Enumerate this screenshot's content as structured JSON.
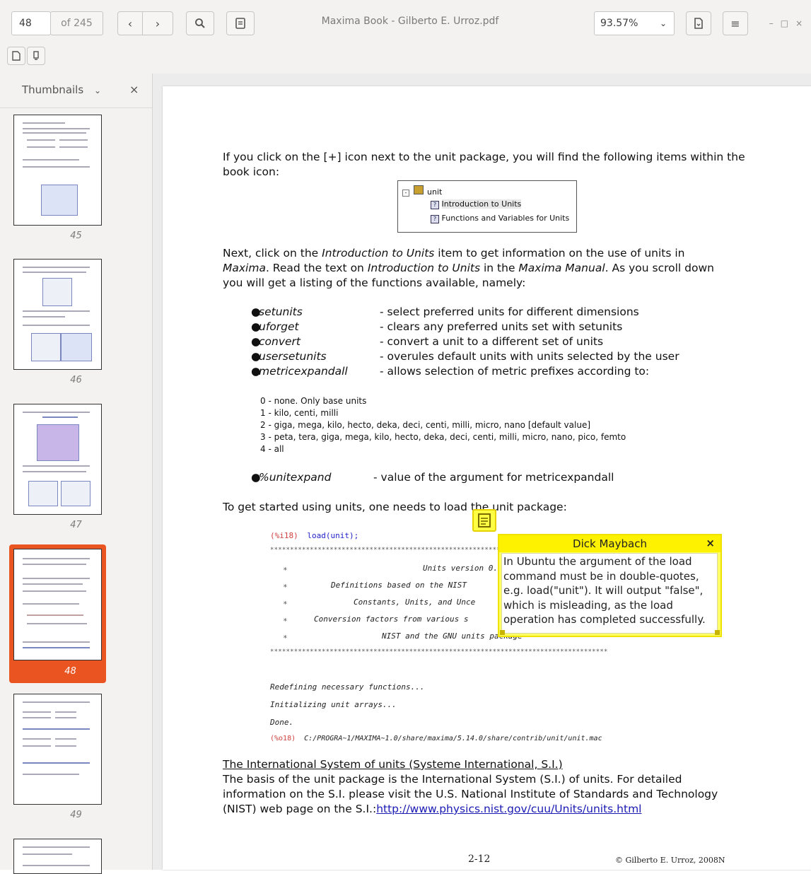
{
  "toolbar": {
    "page_current": "48",
    "page_total": "of 245",
    "document_title": "Maxima Book - Gilberto E. Urroz.pdf",
    "zoom": "93.57%"
  },
  "sidebar": {
    "title": "Thumbnails",
    "close": "×",
    "thumbnails": [
      {
        "label": "45"
      },
      {
        "label": "46"
      },
      {
        "label": "47"
      },
      {
        "label": "48",
        "selected": true
      },
      {
        "label": "49"
      }
    ]
  },
  "page": {
    "intro": "If you click on the [+] icon next to the unit package, you will find the following items within the book icon:",
    "tree": {
      "root": "unit",
      "item1": "Introduction to Units",
      "item2": "Functions and Variables for Units"
    },
    "para2_a": "Next, click on the ",
    "para2_b": "Introduction to Units",
    "para2_c": " item to get information on the use of units in",
    "para2_line2_a": "Maxima",
    "para2_line2_b": ".  Read the text on ",
    "para2_line2_c": "Introduction to Units",
    "para2_line2_d": " in the ",
    "para2_line2_e": "Maxima Manual",
    "para2_line2_f": ".  As you scroll down",
    "para2_line3": "you will get a listing of the functions available, namely:",
    "bullets": [
      {
        "name": "setunits",
        "desc": "- select preferred units for different dimensions"
      },
      {
        "name": "uforget",
        "desc": "- clears any preferred units set with setunits"
      },
      {
        "name": "convert",
        "desc": "- convert  a unit to a different set of units"
      },
      {
        "name": "usersetunits",
        "desc": "- overules default units with units selected by the user"
      },
      {
        "name": "metricexpandall",
        "desc": "- allows selection of metric prefixes according to:"
      }
    ],
    "levels": [
      "0 - none. Only base units",
      "1 - kilo, centi, milli",
      "2 - giga, mega, kilo, hecto, deka, deci, centi, milli, micro, nano  [default value]",
      "3 - peta, tera, giga, mega, kilo, hecto, deka, deci, centi, milli, micro, nano, pico, femto",
      "4 - all"
    ],
    "last_bullet": {
      "name": "%unitexpand",
      "desc": "- value of the argument for metricexpandall"
    },
    "started": "To get started using units, one needs to load the unit package:",
    "code_in_label": "(%i18)",
    "code_in": "load(unit);",
    "stars": "*************************************************************************************",
    "code_lines": [
      "Units version 0.5",
      "Definitions based on the NIST",
      "Constants, Units, and Unce",
      "Conversion factors from various s",
      "NIST and the GNU units package"
    ],
    "redefining": "Redefining necessary functions...",
    "initializing": "Initializing unit arrays...",
    "done": "Done.",
    "code_out_label": "(%o18)",
    "code_out": "C:/PROGRA~1/MAXIMA~1.0/share/maxima/5.14.0/share/contrib/unit/unit.mac",
    "si_heading": "The International System of units (Systeme International, S.I.)",
    "si_line1": "The basis of the unit package is the International System (S.I.) of units.  For detailed",
    "si_line2": "information on the S.I. please visit the U.S. National Institute of Standards and Technology",
    "si_line3_a": "(NIST) web page on the S.I.:",
    "si_link": "http://www.physics.nist.gov/cuu/Units/units.html",
    "footer_page": "2-12",
    "footer_copy": "© Gilberto E. Urroz, 2008N"
  },
  "annotation": {
    "author": "Dick Maybach",
    "close": "×",
    "text": "In Ubuntu the argument of the load command must be in double-quotes, e.g. load(\"unit\"). It will output \"false\", which is misleading, as the load operation has completed successfully."
  },
  "colors": {
    "accent": "#e95420",
    "note_head": "#fff200",
    "note_bg": "#ffff66",
    "code_label": "#d04040",
    "code_input": "#2222cc"
  }
}
